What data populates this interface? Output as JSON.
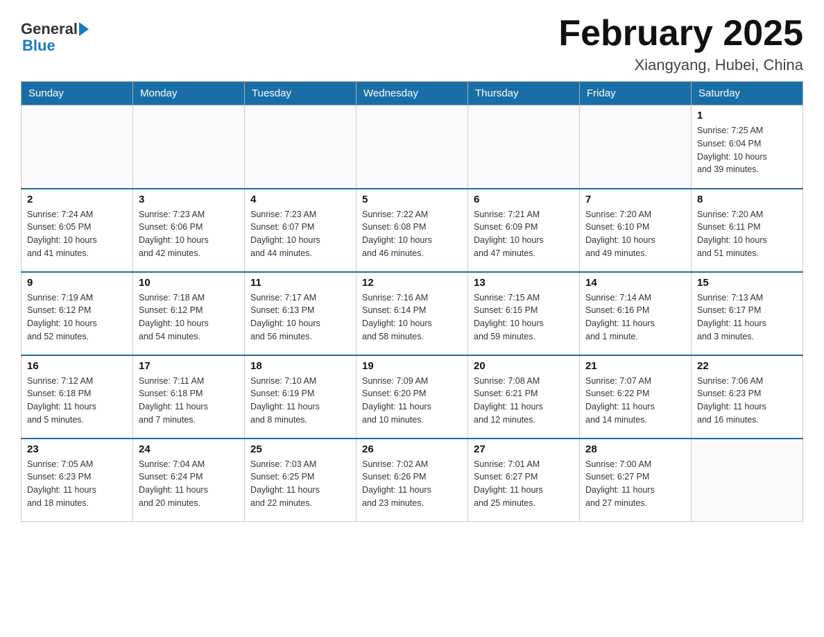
{
  "header": {
    "logo_general": "General",
    "logo_blue": "Blue",
    "title": "February 2025",
    "location": "Xiangyang, Hubei, China"
  },
  "days_of_week": [
    "Sunday",
    "Monday",
    "Tuesday",
    "Wednesday",
    "Thursday",
    "Friday",
    "Saturday"
  ],
  "weeks": [
    [
      {
        "day": "",
        "info": ""
      },
      {
        "day": "",
        "info": ""
      },
      {
        "day": "",
        "info": ""
      },
      {
        "day": "",
        "info": ""
      },
      {
        "day": "",
        "info": ""
      },
      {
        "day": "",
        "info": ""
      },
      {
        "day": "1",
        "info": "Sunrise: 7:25 AM\nSunset: 6:04 PM\nDaylight: 10 hours\nand 39 minutes."
      }
    ],
    [
      {
        "day": "2",
        "info": "Sunrise: 7:24 AM\nSunset: 6:05 PM\nDaylight: 10 hours\nand 41 minutes."
      },
      {
        "day": "3",
        "info": "Sunrise: 7:23 AM\nSunset: 6:06 PM\nDaylight: 10 hours\nand 42 minutes."
      },
      {
        "day": "4",
        "info": "Sunrise: 7:23 AM\nSunset: 6:07 PM\nDaylight: 10 hours\nand 44 minutes."
      },
      {
        "day": "5",
        "info": "Sunrise: 7:22 AM\nSunset: 6:08 PM\nDaylight: 10 hours\nand 46 minutes."
      },
      {
        "day": "6",
        "info": "Sunrise: 7:21 AM\nSunset: 6:09 PM\nDaylight: 10 hours\nand 47 minutes."
      },
      {
        "day": "7",
        "info": "Sunrise: 7:20 AM\nSunset: 6:10 PM\nDaylight: 10 hours\nand 49 minutes."
      },
      {
        "day": "8",
        "info": "Sunrise: 7:20 AM\nSunset: 6:11 PM\nDaylight: 10 hours\nand 51 minutes."
      }
    ],
    [
      {
        "day": "9",
        "info": "Sunrise: 7:19 AM\nSunset: 6:12 PM\nDaylight: 10 hours\nand 52 minutes."
      },
      {
        "day": "10",
        "info": "Sunrise: 7:18 AM\nSunset: 6:12 PM\nDaylight: 10 hours\nand 54 minutes."
      },
      {
        "day": "11",
        "info": "Sunrise: 7:17 AM\nSunset: 6:13 PM\nDaylight: 10 hours\nand 56 minutes."
      },
      {
        "day": "12",
        "info": "Sunrise: 7:16 AM\nSunset: 6:14 PM\nDaylight: 10 hours\nand 58 minutes."
      },
      {
        "day": "13",
        "info": "Sunrise: 7:15 AM\nSunset: 6:15 PM\nDaylight: 10 hours\nand 59 minutes."
      },
      {
        "day": "14",
        "info": "Sunrise: 7:14 AM\nSunset: 6:16 PM\nDaylight: 11 hours\nand 1 minute."
      },
      {
        "day": "15",
        "info": "Sunrise: 7:13 AM\nSunset: 6:17 PM\nDaylight: 11 hours\nand 3 minutes."
      }
    ],
    [
      {
        "day": "16",
        "info": "Sunrise: 7:12 AM\nSunset: 6:18 PM\nDaylight: 11 hours\nand 5 minutes."
      },
      {
        "day": "17",
        "info": "Sunrise: 7:11 AM\nSunset: 6:18 PM\nDaylight: 11 hours\nand 7 minutes."
      },
      {
        "day": "18",
        "info": "Sunrise: 7:10 AM\nSunset: 6:19 PM\nDaylight: 11 hours\nand 8 minutes."
      },
      {
        "day": "19",
        "info": "Sunrise: 7:09 AM\nSunset: 6:20 PM\nDaylight: 11 hours\nand 10 minutes."
      },
      {
        "day": "20",
        "info": "Sunrise: 7:08 AM\nSunset: 6:21 PM\nDaylight: 11 hours\nand 12 minutes."
      },
      {
        "day": "21",
        "info": "Sunrise: 7:07 AM\nSunset: 6:22 PM\nDaylight: 11 hours\nand 14 minutes."
      },
      {
        "day": "22",
        "info": "Sunrise: 7:06 AM\nSunset: 6:23 PM\nDaylight: 11 hours\nand 16 minutes."
      }
    ],
    [
      {
        "day": "23",
        "info": "Sunrise: 7:05 AM\nSunset: 6:23 PM\nDaylight: 11 hours\nand 18 minutes."
      },
      {
        "day": "24",
        "info": "Sunrise: 7:04 AM\nSunset: 6:24 PM\nDaylight: 11 hours\nand 20 minutes."
      },
      {
        "day": "25",
        "info": "Sunrise: 7:03 AM\nSunset: 6:25 PM\nDaylight: 11 hours\nand 22 minutes."
      },
      {
        "day": "26",
        "info": "Sunrise: 7:02 AM\nSunset: 6:26 PM\nDaylight: 11 hours\nand 23 minutes."
      },
      {
        "day": "27",
        "info": "Sunrise: 7:01 AM\nSunset: 6:27 PM\nDaylight: 11 hours\nand 25 minutes."
      },
      {
        "day": "28",
        "info": "Sunrise: 7:00 AM\nSunset: 6:27 PM\nDaylight: 11 hours\nand 27 minutes."
      },
      {
        "day": "",
        "info": ""
      }
    ]
  ]
}
